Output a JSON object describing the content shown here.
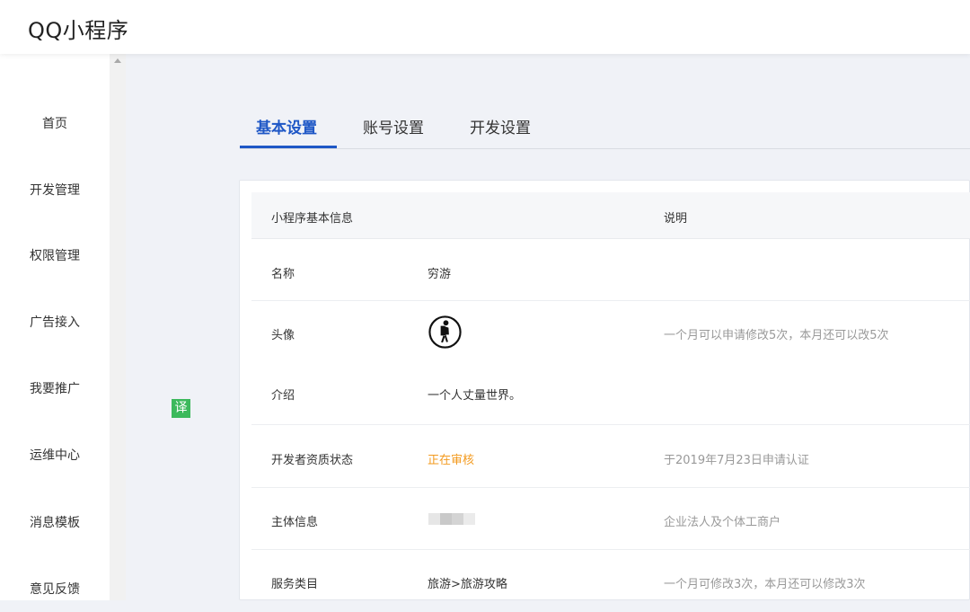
{
  "app": {
    "title": "QQ小程序"
  },
  "sidebar": {
    "items": [
      {
        "label": "首页"
      },
      {
        "label": "开发管理"
      },
      {
        "label": "权限管理"
      },
      {
        "label": "广告接入"
      },
      {
        "label": "我要推广"
      },
      {
        "label": "运维中心"
      },
      {
        "label": "消息模板"
      },
      {
        "label": "意见反馈"
      }
    ]
  },
  "translate_badge": {
    "label": "译"
  },
  "tabs": [
    {
      "label": "基本设置",
      "active": true
    },
    {
      "label": "账号设置",
      "active": false
    },
    {
      "label": "开发设置",
      "active": false
    }
  ],
  "table": {
    "headers": {
      "info": "小程序基本信息",
      "note": "说明"
    },
    "rows": [
      {
        "label": "名称",
        "value": "穷游",
        "note": ""
      },
      {
        "label": "头像",
        "value_icon": "backpacker-avatar-icon",
        "note": "一个月可以申请修改5次，本月还可以改5次"
      },
      {
        "label": "介绍",
        "value": "一个人丈量世界。",
        "note": ""
      },
      {
        "label": "开发者资质状态",
        "value": "正在审核",
        "note": "于2019年7月23日申请认证"
      },
      {
        "label": "主体信息",
        "value_icon": "blurred-entity-name",
        "note": "企业法人及个体工商户"
      },
      {
        "label": "服务类目",
        "value": "旅游>旅游攻略",
        "note": "一个月可修改3次，本月还可以修改3次"
      }
    ]
  },
  "colors": {
    "accent": "#1e57c6",
    "pending": "#f39a1e",
    "badge": "#3cb95c",
    "note_text": "#999999"
  }
}
